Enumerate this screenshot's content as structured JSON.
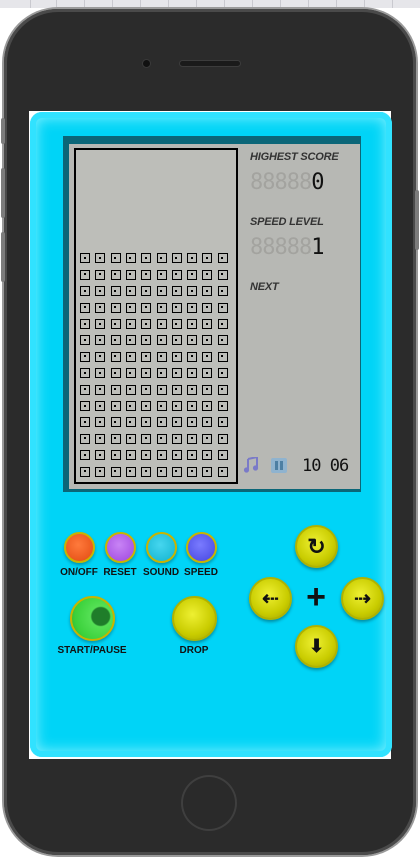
{
  "panel": {
    "highest_score_label": "HIGHEST SCORE",
    "highest_score_ghost": "88888",
    "highest_score_value": "0",
    "speed_level_label": "SPEED LEVEL",
    "speed_level_ghost": "88888",
    "speed_level_value": "1",
    "next_label": "NEXT",
    "music_icon": "music-note-icon",
    "pause_icon": "pause-icon",
    "clock_text": "10 06"
  },
  "controls": {
    "on_off_label": "ON/OFF",
    "reset_label": "RESET",
    "sound_label": "SOUND",
    "speed_label": "SPEED",
    "start_pause_label": "START/PAUSE",
    "drop_label": "DROP",
    "rotate_icon": "↻",
    "left_icon": "⇠",
    "right_icon": "⇢",
    "down_icon": "⬇",
    "center_icon": "+"
  },
  "board": {
    "columns": 10,
    "filled_rows": 14,
    "block_color": "#000000"
  },
  "colors": {
    "console": "#00d4f7",
    "on_off": "#f05a1e",
    "reset": "#b55ce8",
    "sound": "#19c4dd",
    "speed": "#5b5cf0",
    "start": "#3fd63f",
    "yellow": "#d6d800"
  }
}
